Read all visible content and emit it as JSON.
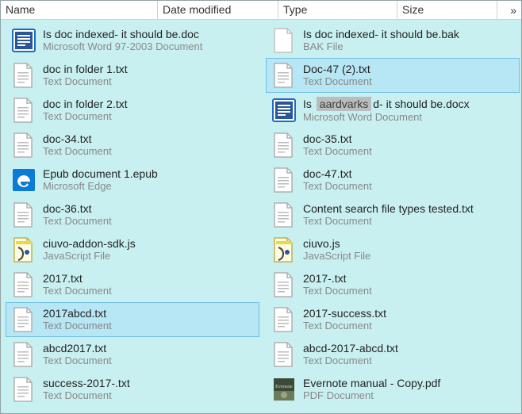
{
  "header": {
    "name": "Name",
    "date": "Date modified",
    "type": "Type",
    "size": "Size",
    "more": "»"
  },
  "left": [
    {
      "icon": "doc-word",
      "name": "Is doc indexed- it should be.doc",
      "type": "Microsoft Word 97-2003 Document",
      "sel": false
    },
    {
      "icon": "txt",
      "name": "doc in folder 1.txt",
      "type": "Text Document",
      "sel": false
    },
    {
      "icon": "txt",
      "name": "doc in folder 2.txt",
      "type": "Text Document",
      "sel": false
    },
    {
      "icon": "txt",
      "name": "doc-34.txt",
      "type": "Text Document",
      "sel": false
    },
    {
      "icon": "edge",
      "name": "Epub document 1.epub",
      "type": "Microsoft Edge",
      "sel": false
    },
    {
      "icon": "txt",
      "name": "doc-36.txt",
      "type": "Text Document",
      "sel": false
    },
    {
      "icon": "js",
      "name": "ciuvo-addon-sdk.js",
      "type": "JavaScript File",
      "sel": false
    },
    {
      "icon": "txt",
      "name": "2017.txt",
      "type": "Text Document",
      "sel": false
    },
    {
      "icon": "txt",
      "name": "2017abcd.txt",
      "type": "Text Document",
      "sel": true
    },
    {
      "icon": "txt",
      "name": "abcd2017.txt",
      "type": "Text Document",
      "sel": false
    },
    {
      "icon": "txt",
      "name": "success-2017-.txt",
      "type": "Text Document",
      "sel": false
    }
  ],
  "right": [
    {
      "icon": "blank",
      "name": "Is doc indexed- it should be.bak",
      "type": "BAK File",
      "sel": false
    },
    {
      "icon": "txt",
      "name": "Doc-47 (2).txt",
      "type": "Text Document",
      "sel": true
    },
    {
      "icon": "docx",
      "rename": true,
      "name_pre": "Is ",
      "name_edit": "aardvarks",
      "name_post": "d- it should be.docx",
      "type": "Microsoft Word Document",
      "sel": false
    },
    {
      "icon": "txt",
      "name": "doc-35.txt",
      "type": "Text Document",
      "sel": false
    },
    {
      "icon": "txt",
      "name": "doc-47.txt",
      "type": "Text Document",
      "sel": false
    },
    {
      "icon": "txt",
      "name": "Content search file types tested.txt",
      "type": "Text Document",
      "sel": false
    },
    {
      "icon": "js",
      "name": "ciuvo.js",
      "type": "JavaScript File",
      "sel": false
    },
    {
      "icon": "txt",
      "name": "2017-.txt",
      "type": "Text Document",
      "sel": false
    },
    {
      "icon": "txt",
      "name": "2017-success.txt",
      "type": "Text Document",
      "sel": false
    },
    {
      "icon": "txt",
      "name": "abcd-2017-abcd.txt",
      "type": "Text Document",
      "sel": false
    },
    {
      "icon": "pdf-evernote",
      "name": "Evernote manual - Copy.pdf",
      "type": "PDF Document",
      "sel": false
    }
  ]
}
